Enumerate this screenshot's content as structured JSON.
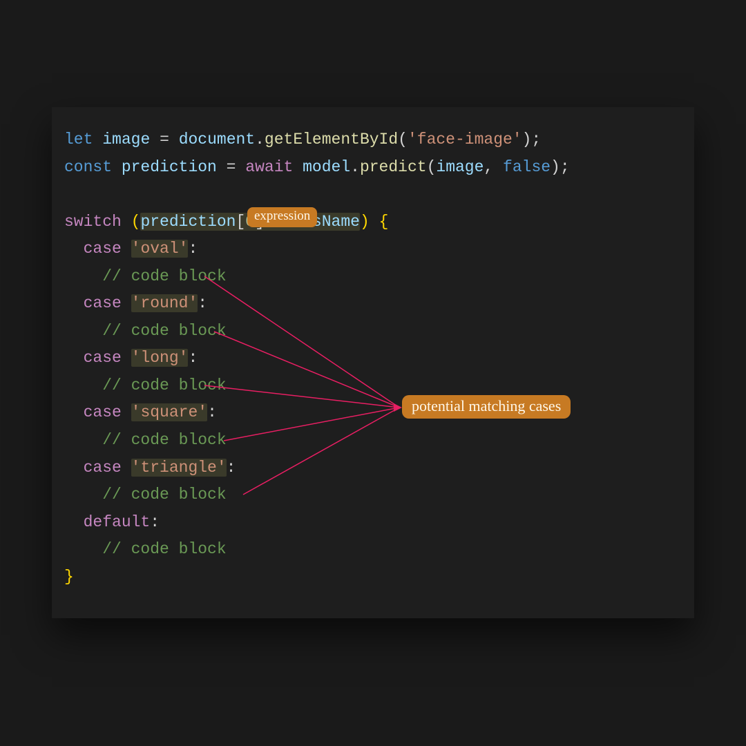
{
  "code": {
    "let": "let",
    "const": "const",
    "await": "await",
    "switch": "switch",
    "case": "case",
    "default": "default",
    "image_var": "image",
    "prediction_var": "prediction",
    "document": "document",
    "getElementById": "getElementById",
    "model": "model",
    "predict": "predict",
    "face_image_str": "'face-image'",
    "false_kw": "false",
    "zero": "0",
    "className": "className",
    "oval": "'oval'",
    "round": "'round'",
    "long": "'long'",
    "square": "'square'",
    "triangle": "'triangle'",
    "code_block_comment": "// code block"
  },
  "annotations": {
    "expression": "expression",
    "potential": "potential matching cases"
  }
}
